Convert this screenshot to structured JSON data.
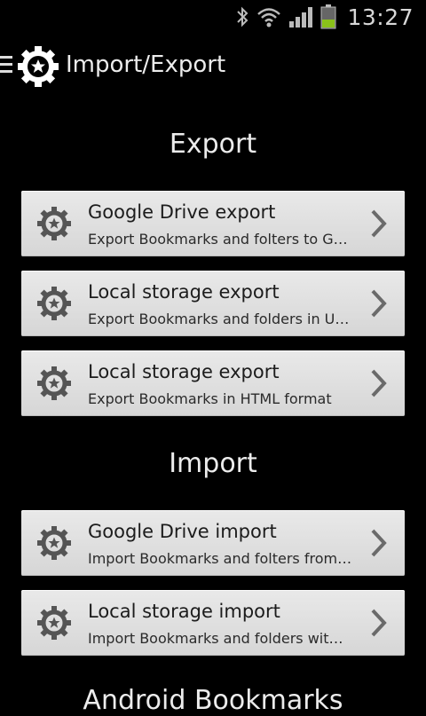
{
  "status": {
    "time": "13:27"
  },
  "header": {
    "title": "Import/Export"
  },
  "sections": {
    "export_label": "Export",
    "import_label": "Import",
    "android_label": "Android Bookmarks"
  },
  "export_items": [
    {
      "title": "Google Drive export",
      "subtitle": "Export Bookmarks and folters to G…"
    },
    {
      "title": "Local storage export",
      "subtitle": "Export Bookmarks and folders in U…"
    },
    {
      "title": "Local storage export",
      "subtitle": "Export Bookmarks in HTML format"
    }
  ],
  "import_items": [
    {
      "title": "Google Drive import",
      "subtitle": "Import Bookmarks and folters from…"
    },
    {
      "title": "Local storage import",
      "subtitle": "Import Bookmarks and folders wit…"
    }
  ],
  "icons": {
    "status": [
      "bluetooth-icon",
      "wifi-icon",
      "signal-icon",
      "battery-icon"
    ],
    "header": [
      "drawer-icon",
      "gear-icon"
    ],
    "item": [
      "gear-icon",
      "chevron-right-icon"
    ]
  },
  "colors": {
    "battery_level": "#8ac11a",
    "card_bg": "#dcdcdc"
  }
}
